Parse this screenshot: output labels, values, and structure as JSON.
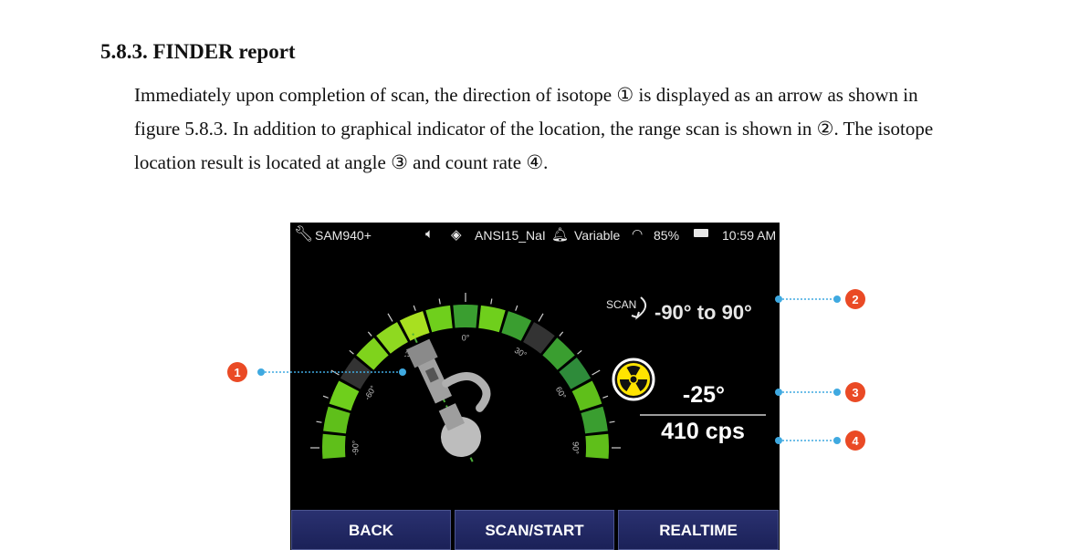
{
  "section": {
    "heading": "5.8.3. FINDER report",
    "paragraph_lines": [
      "Immediately upon completion of scan, the direction of isotope ① is displayed as an arrow as shown in",
      "figure 5.8.3. In addition to graphical indicator of the location, the range scan is shown in ②. The isotope",
      "location result is located at angle ③ and count rate ④."
    ]
  },
  "device": {
    "status_bar": {
      "device_name": "SAM940+",
      "library": "ANSI15_NaI",
      "mode": "Variable",
      "battery": "85%",
      "time": "10:59 AM"
    },
    "scan_label": "SCAN",
    "scan_range": "-90° to 90°",
    "angle": "-25°",
    "count_rate": "410 cps",
    "dial_ticks": [
      "-90°",
      "-60°",
      "-30°",
      "0°",
      "30°",
      "60°",
      "90°"
    ],
    "segment_colors": [
      "#5fbf1a",
      "#5fbf1a",
      "#6fcf1c",
      "#333333",
      "#7fd31c",
      "#8fd920",
      "#a8e020",
      "#6fcf1c",
      "#3a9e30",
      "#6fcf1c",
      "#3a9e30",
      "#333333",
      "#3a9e30",
      "#2e8b3a",
      "#5fbf1a",
      "#3a9e30",
      "#5fbf1a"
    ],
    "buttons": {
      "back": "BACK",
      "scan_start": "SCAN/START",
      "realtime": "REALTIME"
    }
  },
  "callouts": [
    "1",
    "2",
    "3",
    "4"
  ],
  "colors": {
    "callout_red": "#ea4a25",
    "callout_line": "#3fa9e0",
    "bar_green": "#5fbf1a",
    "button_blue": "#1f2660"
  }
}
